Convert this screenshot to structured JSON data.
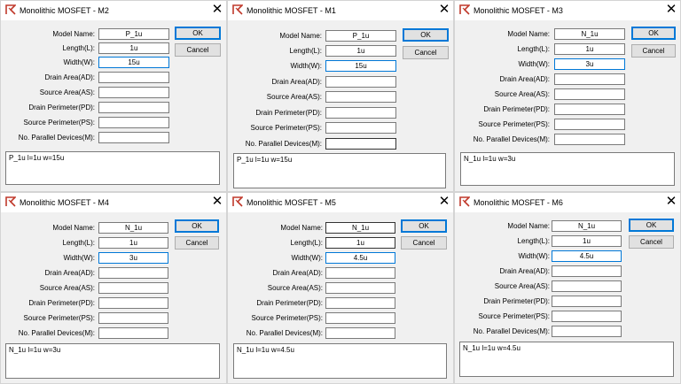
{
  "labels": {
    "model_name": "Model Name:",
    "length": "Length(L):",
    "width": "Width(W):",
    "drain_area": "Drain Area(AD):",
    "source_area": "Source Area(AS):",
    "drain_perimeter": "Drain Perimeter(PD):",
    "source_perimeter": "Source Perimeter(PS):",
    "parallel_devices": "No. Parallel Devices(M):"
  },
  "buttons": {
    "ok": "OK",
    "cancel": "Cancel"
  },
  "close_glyph": "✕",
  "dialogs": [
    {
      "title": "Monolithic MOSFET - M2",
      "model_name": "P_1u",
      "length": "1u",
      "width": "15u",
      "drain_area": "",
      "source_area": "",
      "drain_perimeter": "",
      "source_perimeter": "",
      "parallel_devices": "",
      "summary": "P_1u l=1u w=15u"
    },
    {
      "title": "Monolithic MOSFET - M1",
      "model_name": "P_1u",
      "length": "1u",
      "width": "15u",
      "drain_area": "",
      "source_area": "",
      "drain_perimeter": "",
      "source_perimeter": "",
      "parallel_devices": "",
      "summary": "P_1u l=1u w=15u"
    },
    {
      "title": "Monolithic MOSFET - M3",
      "model_name": "N_1u",
      "length": "1u",
      "width": "3u",
      "drain_area": "",
      "source_area": "",
      "drain_perimeter": "",
      "source_perimeter": "",
      "parallel_devices": "",
      "summary": "N_1u l=1u w=3u"
    },
    {
      "title": "Monolithic MOSFET - M4",
      "model_name": "N_1u",
      "length": "1u",
      "width": "3u",
      "drain_area": "",
      "source_area": "",
      "drain_perimeter": "",
      "source_perimeter": "",
      "parallel_devices": "",
      "summary": "N_1u l=1u w=3u"
    },
    {
      "title": "Monolithic MOSFET - M5",
      "model_name": "N_1u",
      "length": "1u",
      "width": "4.5u",
      "drain_area": "",
      "source_area": "",
      "drain_perimeter": "",
      "source_perimeter": "",
      "parallel_devices": "",
      "summary": "N_1u l=1u w=4.5u"
    },
    {
      "title": "Monolithic MOSFET - M6",
      "model_name": "N_1u",
      "length": "1u",
      "width": "4.5u",
      "drain_area": "",
      "source_area": "",
      "drain_perimeter": "",
      "source_perimeter": "",
      "parallel_devices": "",
      "summary": "N_1u l=1u w=4.5u"
    }
  ],
  "icon": "mosfet-app-icon",
  "colors": {
    "focus_border": "#0078d7",
    "icon_red": "#c0392b"
  }
}
